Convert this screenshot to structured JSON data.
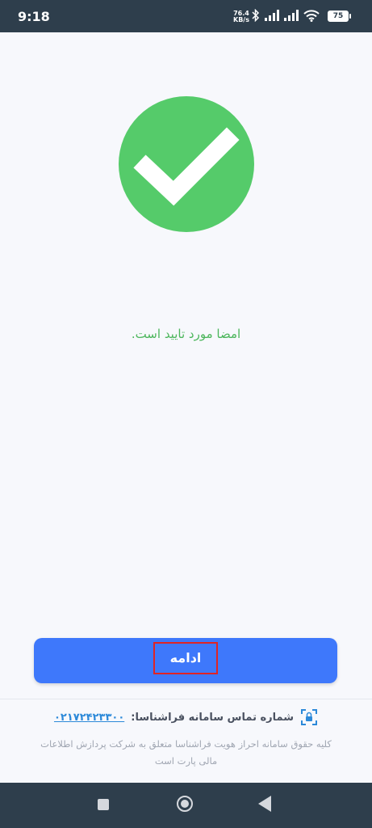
{
  "status_bar": {
    "time": "9:18",
    "network_speed_value": "76.4",
    "network_speed_unit": "KB/s",
    "battery": "75"
  },
  "main": {
    "message": "امضا مورد تایید است."
  },
  "actions": {
    "continue_label": "ادامه"
  },
  "footer": {
    "contact_label": "شماره تماس سامانه فراشناسا:",
    "contact_phone": "۰۲۱۷۲۴۲۳۳۰۰",
    "copyright": "کلیه حقوق سامانه احراز هویت فراشناسا متعلق به شرکت پردازش اطلاعات مالی پارت است"
  },
  "colors": {
    "accent": "#3E78FB",
    "success": "#55CB6A",
    "status_bar": "#2E3E4C"
  }
}
